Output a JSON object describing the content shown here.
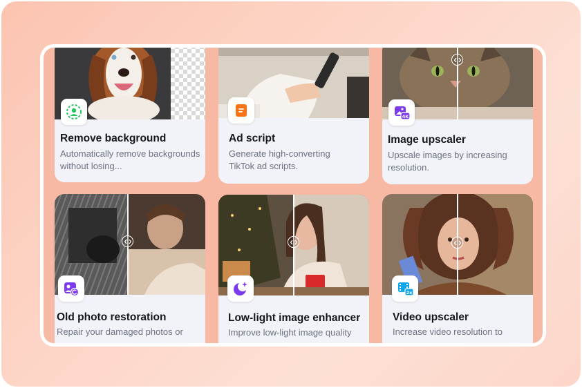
{
  "cards": [
    {
      "title": "Remove background",
      "description": "Automatically remove backgrounds without losing...",
      "icon": "person-cutout-icon"
    },
    {
      "title": "Ad script",
      "description": "Generate high-converting TikTok ad scripts.",
      "icon": "document-icon"
    },
    {
      "title": "Image upscaler",
      "description": "Upscale images by increasing resolution.",
      "icon": "4k-image-icon"
    },
    {
      "title": "Old photo restoration",
      "description": "Repair your damaged photos or",
      "icon": "photo-restore-icon"
    },
    {
      "title": "Low-light image enhancer",
      "description": "Improve low-light image quality",
      "icon": "moon-sparkle-icon"
    },
    {
      "title": "Video upscaler",
      "description": "Increase video resolution to",
      "icon": "2x-video-icon"
    }
  ],
  "colors": {
    "background_gradient_start": "#fcc4b1",
    "background_gradient_end": "#fde0d5",
    "card_background": "#f1f3f8",
    "accent_green": "#22c55e",
    "accent_orange": "#f97316",
    "accent_purple": "#7c3aed",
    "accent_blue": "#0ea5e9"
  }
}
